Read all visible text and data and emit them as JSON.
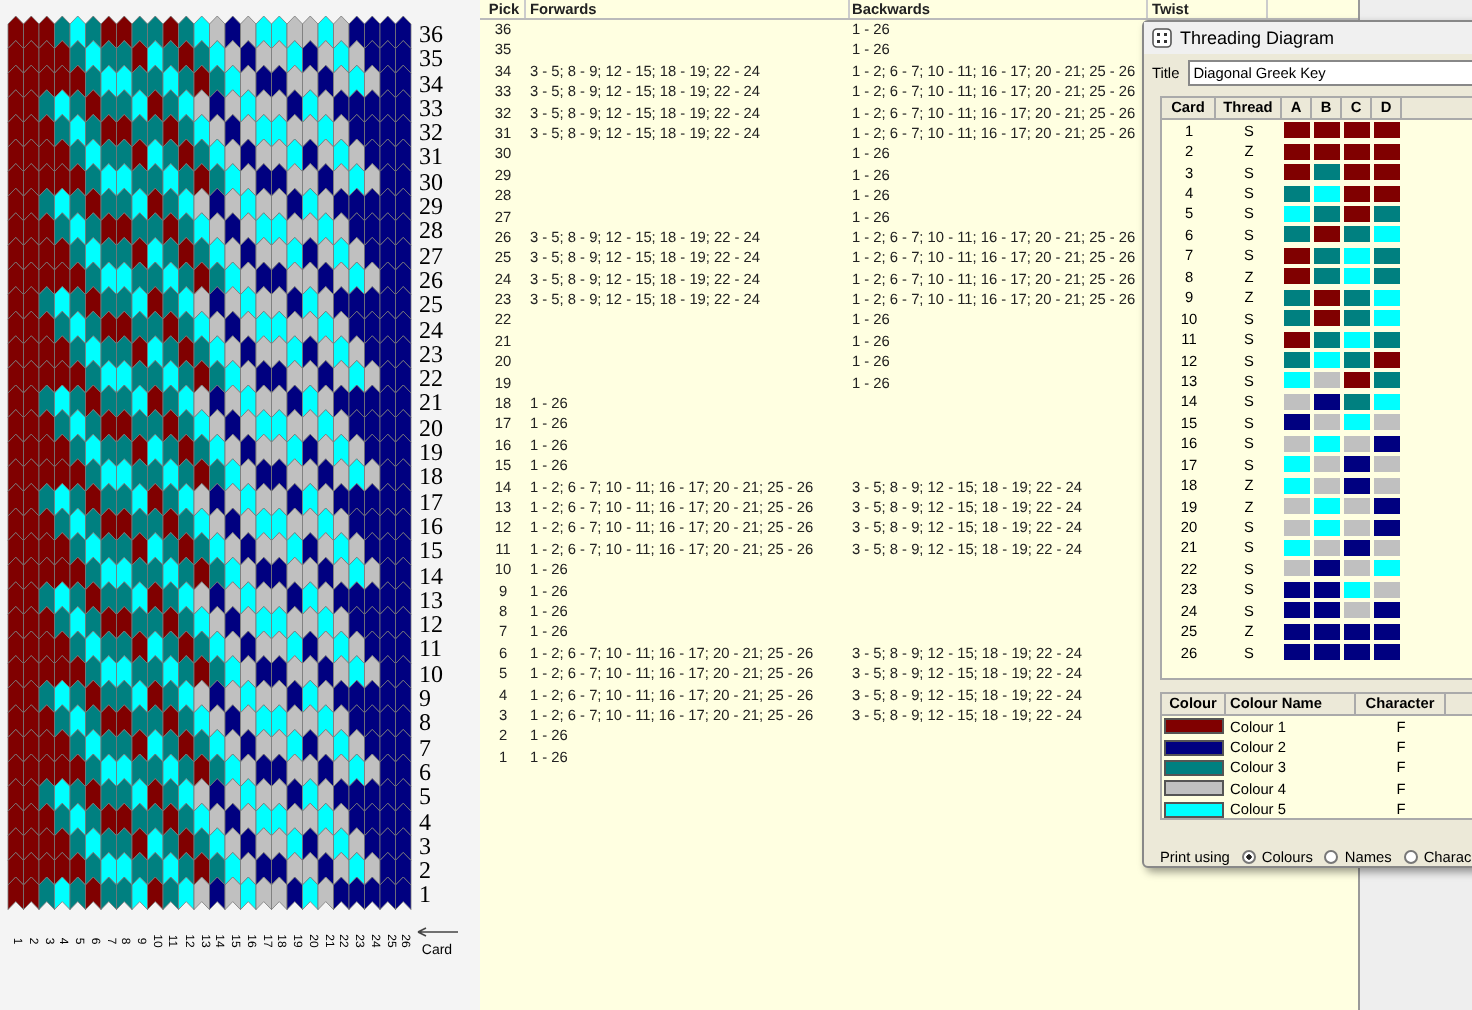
{
  "pattern": {
    "picks": [
      "36",
      "35",
      "34",
      "33",
      "32",
      "31",
      "30",
      "29",
      "28",
      "27",
      "26",
      "25",
      "24",
      "23",
      "22",
      "21",
      "20",
      "19",
      "18",
      "17",
      "16",
      "15",
      "14",
      "13",
      "12",
      "11",
      "10",
      "9",
      "8",
      "7",
      "6",
      "5",
      "4",
      "3",
      "2",
      "1"
    ],
    "cards": [
      "1",
      "2",
      "3",
      "4",
      "5",
      "6",
      "7",
      "8",
      "9",
      "10",
      "11",
      "12",
      "13",
      "14",
      "15",
      "16",
      "17",
      "18",
      "19",
      "20",
      "21",
      "22",
      "23",
      "24",
      "25",
      "26"
    ],
    "card_label": "Card"
  },
  "table": {
    "columns": [
      "Pick",
      "Forwards",
      "Backwards",
      "Twist"
    ],
    "rows": [
      {
        "pick": "36",
        "backwards": "1 - 26"
      },
      {
        "pick": "35",
        "backwards": "1 - 26"
      },
      {
        "pick": "34",
        "forwards": "3 - 5; 8 - 9; 12 - 15; 18 - 19; 22 - 24",
        "backwards": "1 - 2; 6 - 7; 10 - 11; 16 - 17; 20 - 21; 25 - 26"
      },
      {
        "pick": "33",
        "forwards": "3 - 5; 8 - 9; 12 - 15; 18 - 19; 22 - 24",
        "backwards": "1 - 2; 6 - 7; 10 - 11; 16 - 17; 20 - 21; 25 - 26"
      },
      {
        "pick": "32",
        "forwards": "3 - 5; 8 - 9; 12 - 15; 18 - 19; 22 - 24",
        "backwards": "1 - 2; 6 - 7; 10 - 11; 16 - 17; 20 - 21; 25 - 26"
      },
      {
        "pick": "31",
        "forwards": "3 - 5; 8 - 9; 12 - 15; 18 - 19; 22 - 24",
        "backwards": "1 - 2; 6 - 7; 10 - 11; 16 - 17; 20 - 21; 25 - 26"
      },
      {
        "pick": "30",
        "backwards": "1 - 26"
      },
      {
        "pick": "29",
        "backwards": "1 - 26"
      },
      {
        "pick": "28",
        "backwards": "1 - 26"
      },
      {
        "pick": "27",
        "backwards": "1 - 26"
      },
      {
        "pick": "26",
        "forwards": "3 - 5; 8 - 9; 12 - 15; 18 - 19; 22 - 24",
        "backwards": "1 - 2; 6 - 7; 10 - 11; 16 - 17; 20 - 21; 25 - 26"
      },
      {
        "pick": "25",
        "forwards": "3 - 5; 8 - 9; 12 - 15; 18 - 19; 22 - 24",
        "backwards": "1 - 2; 6 - 7; 10 - 11; 16 - 17; 20 - 21; 25 - 26"
      },
      {
        "pick": "24",
        "forwards": "3 - 5; 8 - 9; 12 - 15; 18 - 19; 22 - 24",
        "backwards": "1 - 2; 6 - 7; 10 - 11; 16 - 17; 20 - 21; 25 - 26"
      },
      {
        "pick": "23",
        "forwards": "3 - 5; 8 - 9; 12 - 15; 18 - 19; 22 - 24",
        "backwards": "1 - 2; 6 - 7; 10 - 11; 16 - 17; 20 - 21; 25 - 26"
      },
      {
        "pick": "22",
        "backwards": "1 - 26"
      },
      {
        "pick": "21",
        "backwards": "1 - 26"
      },
      {
        "pick": "20",
        "backwards": "1 - 26"
      },
      {
        "pick": "19",
        "backwards": "1 - 26"
      },
      {
        "pick": "18",
        "forwards": "1 - 26"
      },
      {
        "pick": "17",
        "forwards": "1 - 26"
      },
      {
        "pick": "16",
        "forwards": "1 - 26"
      },
      {
        "pick": "15",
        "forwards": "1 - 26"
      },
      {
        "pick": "14",
        "forwards": "1 - 2; 6 - 7; 10 - 11; 16 - 17; 20 - 21; 25 - 26",
        "backwards": "3 - 5; 8 - 9; 12 - 15; 18 - 19; 22 - 24"
      },
      {
        "pick": "13",
        "forwards": "1 - 2; 6 - 7; 10 - 11; 16 - 17; 20 - 21; 25 - 26",
        "backwards": "3 - 5; 8 - 9; 12 - 15; 18 - 19; 22 - 24"
      },
      {
        "pick": "12",
        "forwards": "1 - 2; 6 - 7; 10 - 11; 16 - 17; 20 - 21; 25 - 26",
        "backwards": "3 - 5; 8 - 9; 12 - 15; 18 - 19; 22 - 24"
      },
      {
        "pick": "11",
        "forwards": "1 - 2; 6 - 7; 10 - 11; 16 - 17; 20 - 21; 25 - 26",
        "backwards": "3 - 5; 8 - 9; 12 - 15; 18 - 19; 22 - 24"
      },
      {
        "pick": "10",
        "forwards": "1 - 26"
      },
      {
        "pick": "9",
        "forwards": "1 - 26"
      },
      {
        "pick": "8",
        "forwards": "1 - 26"
      },
      {
        "pick": "7",
        "forwards": "1 - 26"
      },
      {
        "pick": "6",
        "forwards": "1 - 2; 6 - 7; 10 - 11; 16 - 17; 20 - 21; 25 - 26",
        "backwards": "3 - 5; 8 - 9; 12 - 15; 18 - 19; 22 - 24"
      },
      {
        "pick": "5",
        "forwards": "1 - 2; 6 - 7; 10 - 11; 16 - 17; 20 - 21; 25 - 26",
        "backwards": "3 - 5; 8 - 9; 12 - 15; 18 - 19; 22 - 24"
      },
      {
        "pick": "4",
        "forwards": "1 - 2; 6 - 7; 10 - 11; 16 - 17; 20 - 21; 25 - 26",
        "backwards": "3 - 5; 8 - 9; 12 - 15; 18 - 19; 22 - 24"
      },
      {
        "pick": "3",
        "forwards": "1 - 2; 6 - 7; 10 - 11; 16 - 17; 20 - 21; 25 - 26",
        "backwards": "3 - 5; 8 - 9; 12 - 15; 18 - 19; 22 - 24"
      },
      {
        "pick": "2",
        "forwards": "1 - 26"
      },
      {
        "pick": "1",
        "forwards": "1 - 26"
      }
    ]
  },
  "threading": {
    "title": "Threading Diagram",
    "title_label": "Title",
    "title_value": "Diagonal Greek Key",
    "columns": [
      "Card",
      "Thread",
      "A",
      "B",
      "C",
      "D"
    ],
    "cards": [
      {
        "card": "1",
        "thread": "S",
        "holes": [
          {
            "color": "#800000"
          },
          {
            "color": "#800000"
          },
          {
            "color": "#800000"
          },
          {
            "color": "#800000"
          }
        ]
      },
      {
        "card": "2",
        "thread": "Z",
        "holes": [
          {
            "color": "#800000"
          },
          {
            "color": "#800000"
          },
          {
            "color": "#800000"
          },
          {
            "color": "#800000"
          }
        ]
      },
      {
        "card": "3",
        "thread": "S",
        "holes": [
          {
            "color": "#800000"
          },
          {
            "color": "#008080"
          },
          {
            "color": "#800000"
          },
          {
            "color": "#800000"
          }
        ]
      },
      {
        "card": "4",
        "thread": "S",
        "holes": [
          {
            "color": "#008080"
          },
          {
            "color": "#00ffff"
          },
          {
            "color": "#800000"
          },
          {
            "color": "#800000"
          }
        ]
      },
      {
        "card": "5",
        "thread": "S",
        "holes": [
          {
            "color": "#00ffff"
          },
          {
            "color": "#008080"
          },
          {
            "color": "#800000"
          },
          {
            "color": "#008080"
          }
        ]
      },
      {
        "card": "6",
        "thread": "S",
        "holes": [
          {
            "color": "#008080"
          },
          {
            "color": "#800000"
          },
          {
            "color": "#008080"
          },
          {
            "color": "#00ffff"
          }
        ]
      },
      {
        "card": "7",
        "thread": "S",
        "holes": [
          {
            "color": "#800000"
          },
          {
            "color": "#008080"
          },
          {
            "color": "#00ffff"
          },
          {
            "color": "#008080"
          }
        ]
      },
      {
        "card": "8",
        "thread": "Z",
        "holes": [
          {
            "color": "#800000"
          },
          {
            "color": "#008080"
          },
          {
            "color": "#00ffff"
          },
          {
            "color": "#008080"
          }
        ]
      },
      {
        "card": "9",
        "thread": "Z",
        "holes": [
          {
            "color": "#008080"
          },
          {
            "color": "#800000"
          },
          {
            "color": "#008080"
          },
          {
            "color": "#00ffff"
          }
        ]
      },
      {
        "card": "10",
        "thread": "S",
        "holes": [
          {
            "color": "#008080"
          },
          {
            "color": "#800000"
          },
          {
            "color": "#008080"
          },
          {
            "color": "#00ffff"
          }
        ]
      },
      {
        "card": "11",
        "thread": "S",
        "holes": [
          {
            "color": "#800000"
          },
          {
            "color": "#008080"
          },
          {
            "color": "#00ffff"
          },
          {
            "color": "#008080"
          }
        ]
      },
      {
        "card": "12",
        "thread": "S",
        "holes": [
          {
            "color": "#008080"
          },
          {
            "color": "#00ffff"
          },
          {
            "color": "#008080"
          },
          {
            "color": "#800000"
          }
        ]
      },
      {
        "card": "13",
        "thread": "S",
        "holes": [
          {
            "color": "#00ffff"
          },
          {
            "color": "#c0c0c0"
          },
          {
            "color": "#800000"
          },
          {
            "color": "#008080"
          }
        ]
      },
      {
        "card": "14",
        "thread": "S",
        "holes": [
          {
            "color": "#c0c0c0"
          },
          {
            "color": "#000080"
          },
          {
            "color": "#008080"
          },
          {
            "color": "#00ffff"
          }
        ]
      },
      {
        "card": "15",
        "thread": "S",
        "holes": [
          {
            "color": "#000080"
          },
          {
            "color": "#c0c0c0"
          },
          {
            "color": "#00ffff"
          },
          {
            "color": "#c0c0c0"
          }
        ]
      },
      {
        "card": "16",
        "thread": "S",
        "holes": [
          {
            "color": "#c0c0c0"
          },
          {
            "color": "#00ffff"
          },
          {
            "color": "#c0c0c0"
          },
          {
            "color": "#000080"
          }
        ]
      },
      {
        "card": "17",
        "thread": "S",
        "holes": [
          {
            "color": "#00ffff"
          },
          {
            "color": "#c0c0c0"
          },
          {
            "color": "#000080"
          },
          {
            "color": "#c0c0c0"
          }
        ]
      },
      {
        "card": "18",
        "thread": "Z",
        "holes": [
          {
            "color": "#00ffff"
          },
          {
            "color": "#c0c0c0"
          },
          {
            "color": "#000080"
          },
          {
            "color": "#c0c0c0"
          }
        ]
      },
      {
        "card": "19",
        "thread": "Z",
        "holes": [
          {
            "color": "#c0c0c0"
          },
          {
            "color": "#00ffff"
          },
          {
            "color": "#c0c0c0"
          },
          {
            "color": "#000080"
          }
        ]
      },
      {
        "card": "20",
        "thread": "S",
        "holes": [
          {
            "color": "#c0c0c0"
          },
          {
            "color": "#00ffff"
          },
          {
            "color": "#c0c0c0"
          },
          {
            "color": "#000080"
          }
        ]
      },
      {
        "card": "21",
        "thread": "S",
        "holes": [
          {
            "color": "#00ffff"
          },
          {
            "color": "#c0c0c0"
          },
          {
            "color": "#000080"
          },
          {
            "color": "#c0c0c0"
          }
        ]
      },
      {
        "card": "22",
        "thread": "S",
        "holes": [
          {
            "color": "#c0c0c0"
          },
          {
            "color": "#000080"
          },
          {
            "color": "#c0c0c0"
          },
          {
            "color": "#00ffff"
          }
        ]
      },
      {
        "card": "23",
        "thread": "S",
        "holes": [
          {
            "color": "#000080"
          },
          {
            "color": "#000080"
          },
          {
            "color": "#00ffff"
          },
          {
            "color": "#c0c0c0"
          }
        ]
      },
      {
        "card": "24",
        "thread": "S",
        "holes": [
          {
            "color": "#000080"
          },
          {
            "color": "#000080"
          },
          {
            "color": "#c0c0c0"
          },
          {
            "color": "#000080"
          }
        ]
      },
      {
        "card": "25",
        "thread": "Z",
        "holes": [
          {
            "color": "#000080"
          },
          {
            "color": "#000080"
          },
          {
            "color": "#000080"
          },
          {
            "color": "#000080"
          }
        ]
      },
      {
        "card": "26",
        "thread": "S",
        "holes": [
          {
            "color": "#000080"
          },
          {
            "color": "#000080"
          },
          {
            "color": "#000080"
          },
          {
            "color": "#000080"
          }
        ]
      }
    ],
    "colour_columns": [
      "Colour",
      "Colour Name",
      "Character"
    ],
    "colours": [
      {
        "color": "#800000",
        "name": "Colour 1",
        "character": "F"
      },
      {
        "color": "#000080",
        "name": "Colour 2",
        "character": "F"
      },
      {
        "color": "#008080",
        "name": "Colour 3",
        "character": "F"
      },
      {
        "color": "#c0c0c0",
        "name": "Colour 4",
        "character": "F"
      },
      {
        "color": "#00ffff",
        "name": "Colour 5",
        "character": "F"
      }
    ],
    "print_label": "Print using",
    "print_options": [
      {
        "label": "Colours",
        "selected": true
      },
      {
        "label": "Names",
        "selected": false
      },
      {
        "label": "Charac",
        "selected": false
      }
    ]
  }
}
